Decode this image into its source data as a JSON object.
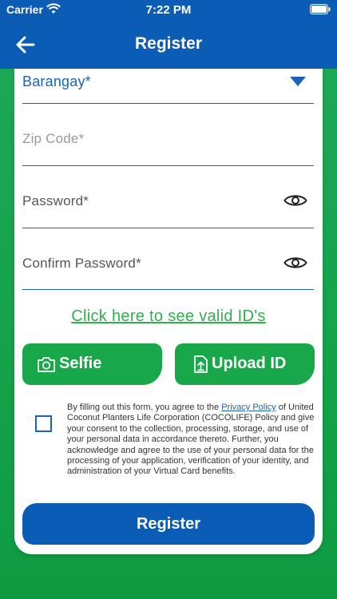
{
  "status_bar": {
    "carrier": "Carrier",
    "time": "7:22 PM"
  },
  "header": {
    "title": "Register"
  },
  "form": {
    "barangay": {
      "label": "Barangay*",
      "color": "#1d63b5"
    },
    "zip_code": {
      "placeholder": "Zip Code*"
    },
    "password": {
      "placeholder": "Password*"
    },
    "confirm_password": {
      "placeholder": "Confirm Password*"
    }
  },
  "valid_ids_link": "Click here to see valid ID's",
  "buttons": {
    "selfie": "Selfie",
    "upload_id": "Upload ID",
    "register": "Register"
  },
  "consent": {
    "before_link": "By filling out this form, you agree to the ",
    "link_text": "Privacy Policy",
    "after_link": " of United Coconut Planters Life Corporation (COCOLIFE) Policy and give your consent to the collection, processing, storage, and use of your personal data in accordance thereto. Further, you acknowledge and agree to the use of your personal data for the processing of your application, verification of your identity, and administration of your Virtual Card benefits.",
    "checked": false
  },
  "colors": {
    "primary_blue": "#0a5cb5",
    "accent_green": "#18a84a",
    "link_green": "#2fb04a"
  },
  "icons": {
    "back": "arrow-left-icon",
    "eye": "eye-icon",
    "camera": "camera-icon",
    "upload": "upload-file-icon",
    "dropdown": "caret-down-icon"
  }
}
